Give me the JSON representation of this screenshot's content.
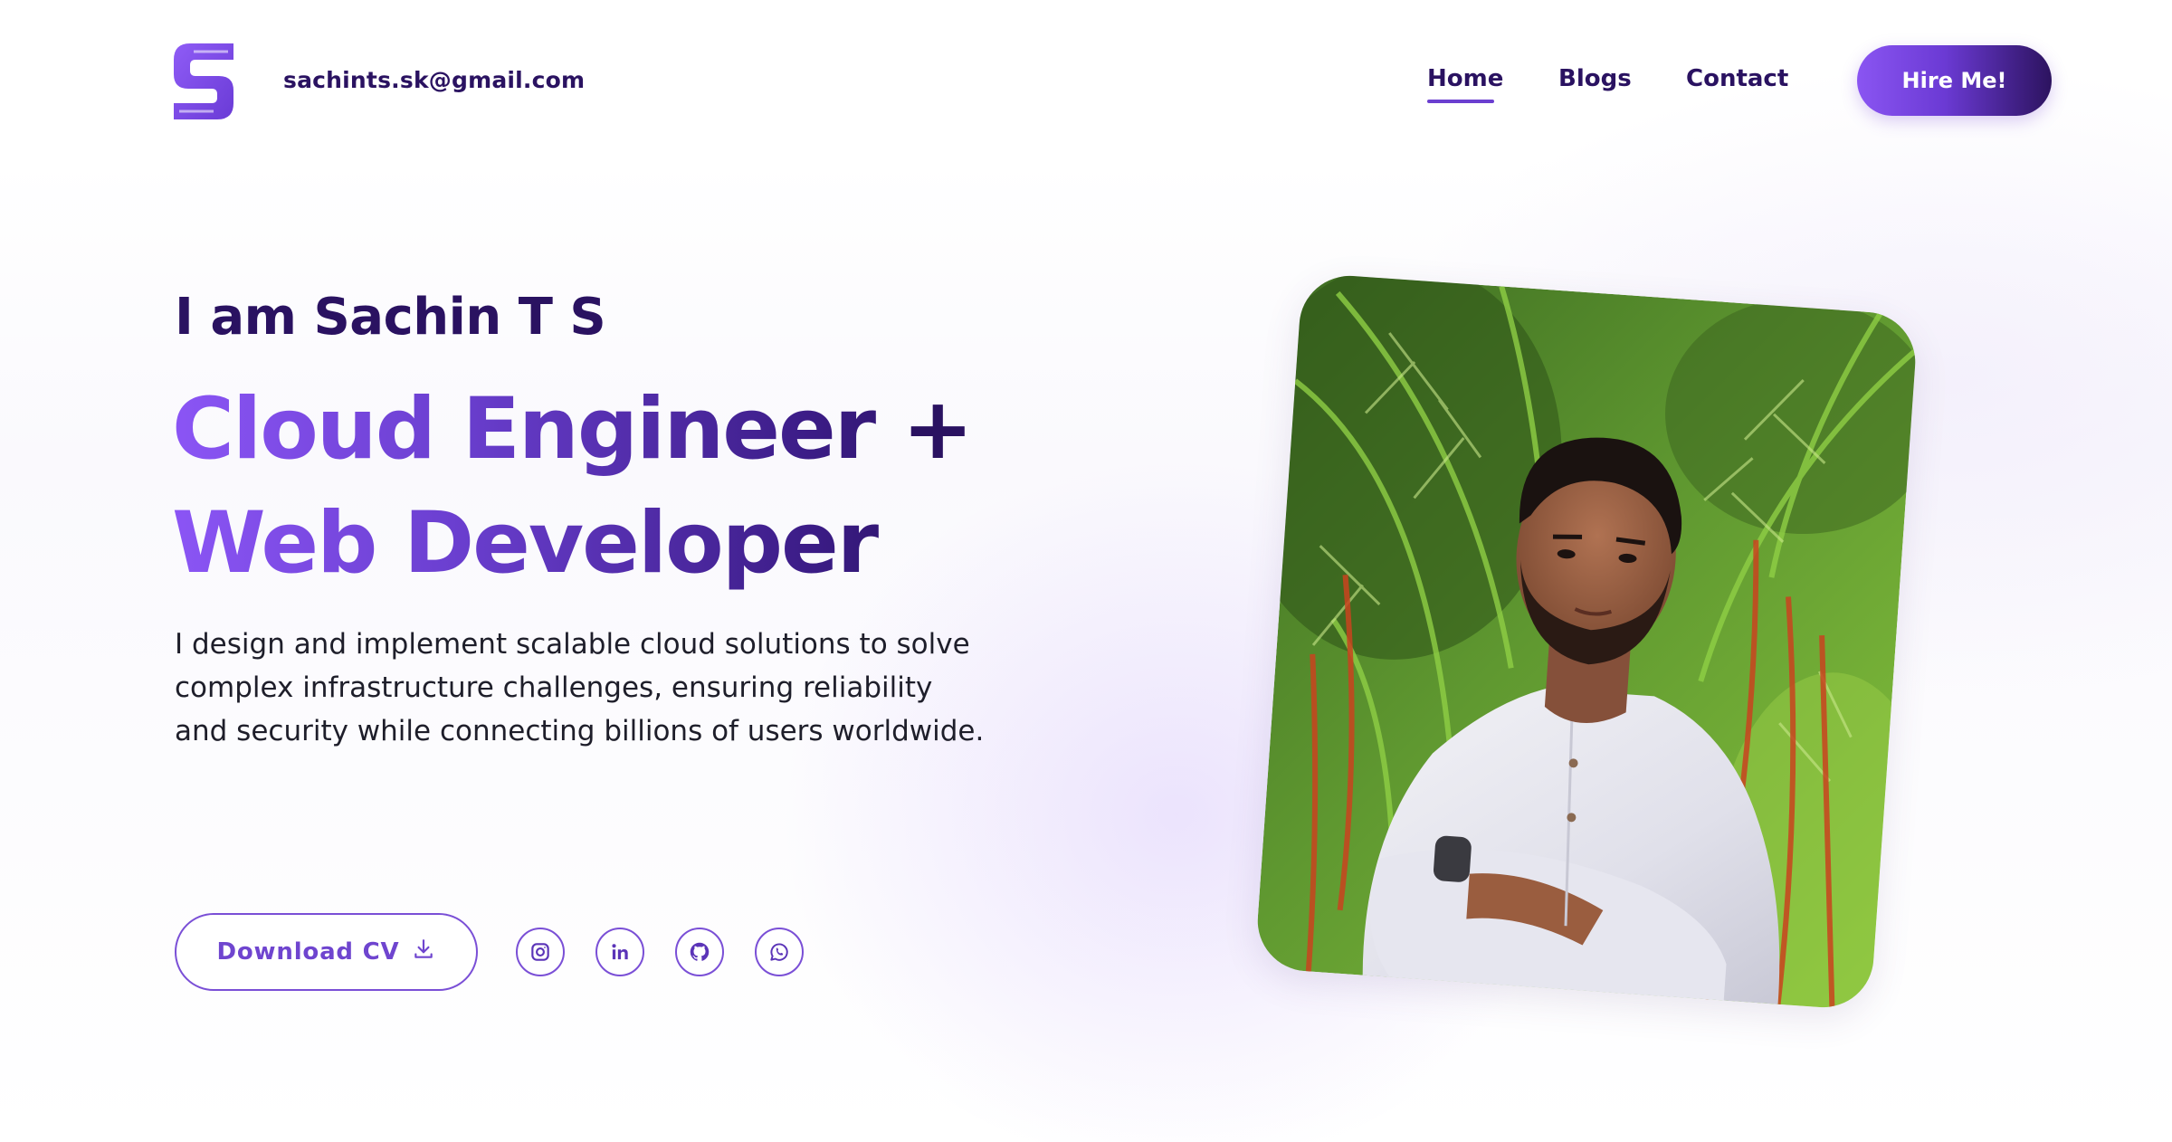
{
  "header": {
    "email": "sachints.sk@gmail.com",
    "nav": [
      {
        "label": "Home",
        "active": true
      },
      {
        "label": "Blogs",
        "active": false
      },
      {
        "label": "Contact",
        "active": false
      }
    ],
    "cta_label": "Hire Me!"
  },
  "hero": {
    "greeting": "I am Sachin T S",
    "headline_line1": "Cloud Engineer +",
    "headline_line1_main": "Cloud Engineer",
    "headline_line1_plus": "+",
    "headline_line2": "Web Developer",
    "description": "I design and implement scalable cloud solutions to solve complex infrastructure challenges, ensuring reliability and security while connecting billions of users worldwide.",
    "download_label": "Download CV",
    "socials": [
      "instagram-icon",
      "linkedin-icon",
      "github-icon",
      "whatsapp-icon"
    ]
  },
  "colors": {
    "accent": "#8b55f5",
    "accent_dark": "#2a1261",
    "text": "#1e1e2a",
    "background": "#ffffff"
  },
  "icons": {
    "logo": "s-letter-logo",
    "download": "download-icon"
  }
}
